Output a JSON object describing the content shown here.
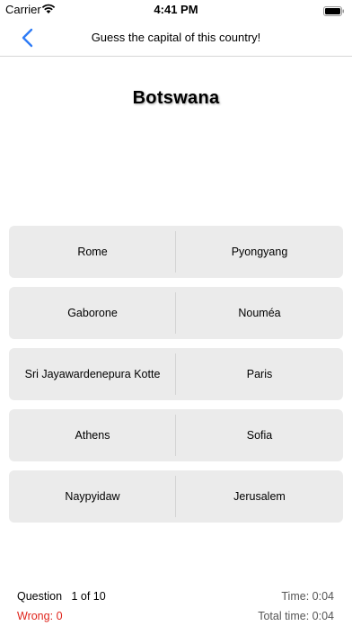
{
  "status_bar": {
    "carrier": "Carrier",
    "time": "4:41 PM"
  },
  "nav": {
    "title": "Guess the capital of this country!"
  },
  "question": {
    "country": "Botswana"
  },
  "answers": [
    {
      "left": "Rome",
      "right": "Pyongyang"
    },
    {
      "left": "Gaborone",
      "right": "Nouméa"
    },
    {
      "left": "Sri Jayawardenepura Kotte",
      "right": "Paris"
    },
    {
      "left": "Athens",
      "right": "Sofia"
    },
    {
      "left": "Naypyidaw",
      "right": "Jerusalem"
    }
  ],
  "footer": {
    "question_label": "Question",
    "question_progress": "1 of 10",
    "wrong_label": "Wrong:",
    "wrong_count": "0",
    "time_label": "Time:",
    "time_value": "0:04",
    "total_time_label": "Total time:",
    "total_time_value": "0:04"
  },
  "colors": {
    "accent": "#2f7cf6",
    "wrong": "#e0241b",
    "button_bg": "#ebebeb"
  }
}
